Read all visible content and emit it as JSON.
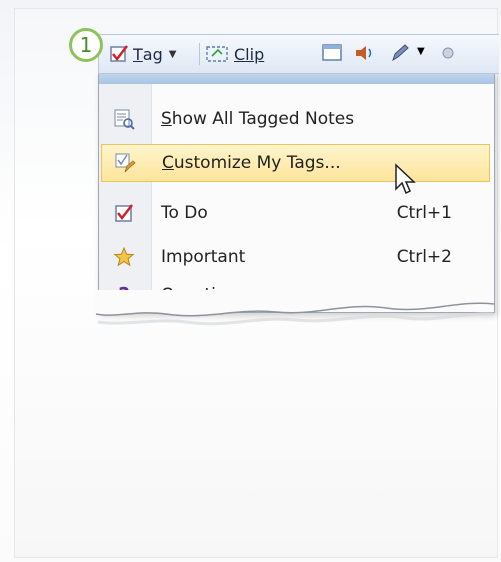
{
  "step": {
    "number": "1"
  },
  "toolbar": {
    "tag_label_underlined": "T",
    "tag_label_rest": "ag",
    "clip_label_underlined": "C",
    "clip_label_rest": "lip"
  },
  "menu": {
    "items": [
      {
        "u": "S",
        "rest": "how All Tagged Notes",
        "shortcut": "",
        "icon": "tagged-notes-icon"
      },
      {
        "u": "C",
        "rest": "ustomize My Tags...",
        "shortcut": "",
        "icon": "customize-tags-icon",
        "highlighted": true
      },
      {
        "u": "",
        "rest": "To Do",
        "shortcut": "Ctrl+1",
        "icon": "checkbox-icon"
      },
      {
        "u": "",
        "rest": "Important",
        "shortcut": "Ctrl+2",
        "icon": "star-icon"
      },
      {
        "u": "",
        "rest": "Question",
        "shortcut": "",
        "icon": "question-mark-icon"
      }
    ]
  },
  "colors": {
    "highlight": "#fde59c",
    "step_ring": "#8fc25a",
    "toolbar": "#dfe8f4"
  }
}
